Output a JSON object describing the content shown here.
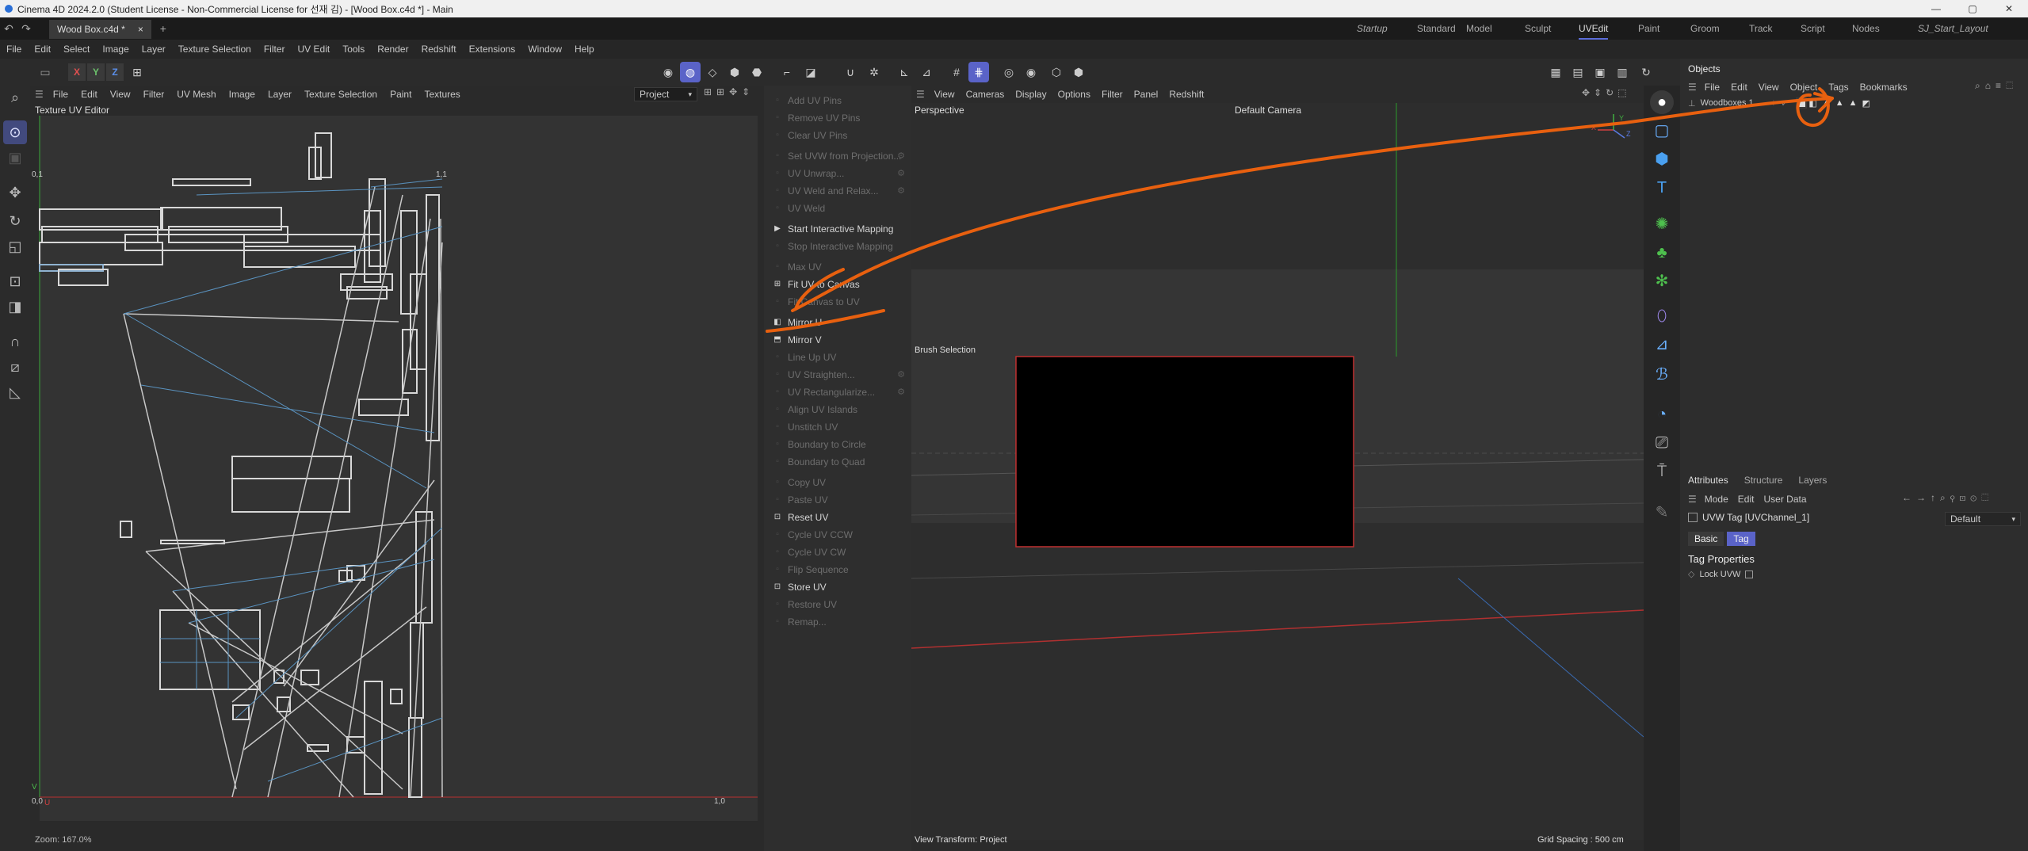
{
  "window": {
    "title": "Cinema 4D 2024.2.0 (Student License - Non-Commercial License for 선재 김) - [Wood Box.c4d *] - Main",
    "minimize": "—",
    "maximize": "▢",
    "close": "✕"
  },
  "tabbar": {
    "doc_tab": "Wood Box.c4d *",
    "doc_close": "×",
    "new_tab": "+",
    "layouts": [
      "Startup",
      "Standard",
      "Model",
      "Sculpt",
      "UVEdit",
      "Paint",
      "Groom",
      "Track",
      "Script",
      "Nodes",
      "SJ_Start_Layout"
    ],
    "active_layout": "UVEdit"
  },
  "menubar": [
    "File",
    "Edit",
    "Select",
    "Image",
    "Layer",
    "Texture Selection",
    "Filter",
    "UV Edit",
    "Tools",
    "Render",
    "Redshift",
    "Extensions",
    "Window",
    "Help"
  ],
  "toolbar": {
    "axes": [
      "X",
      "Y",
      "Z"
    ]
  },
  "uv_editor": {
    "menu": [
      "File",
      "Edit",
      "View",
      "Filter",
      "UV Mesh",
      "Image",
      "Layer",
      "Texture Selection",
      "Paint",
      "Textures"
    ],
    "title": "Texture UV Editor",
    "projection": "Project",
    "corner_tl": "0,1",
    "corner_tr": "1,1",
    "corner_bl": "0,0",
    "corner_br": "1,0",
    "axis_u": "U",
    "axis_v": "V",
    "zoom": "Zoom: 167.0%"
  },
  "uv_commands": [
    {
      "label": "Add UV Pins",
      "enabled": false,
      "gear": false
    },
    {
      "label": "Remove UV Pins",
      "enabled": false,
      "gear": false
    },
    {
      "label": "Clear UV Pins",
      "enabled": false,
      "gear": false
    },
    {
      "sep": true
    },
    {
      "label": "Set UVW from Projection...",
      "enabled": false,
      "gear": true
    },
    {
      "label": "UV Unwrap...",
      "enabled": false,
      "gear": true
    },
    {
      "label": "UV Weld and Relax...",
      "enabled": false,
      "gear": true
    },
    {
      "label": "UV Weld",
      "enabled": false,
      "gear": false
    },
    {
      "sep": true
    },
    {
      "label": "Start Interactive Mapping",
      "enabled": true,
      "gear": false,
      "icon": "▶"
    },
    {
      "label": "Stop Interactive Mapping",
      "enabled": false,
      "gear": false
    },
    {
      "sep": true
    },
    {
      "label": "Max UV",
      "enabled": false,
      "gear": false
    },
    {
      "label": "Fit UV to Canvas",
      "enabled": true,
      "gear": false,
      "icon": "⊞"
    },
    {
      "label": "Fit Canvas to UV",
      "enabled": false,
      "gear": false
    },
    {
      "sep": true
    },
    {
      "label": "Mirror U",
      "enabled": true,
      "gear": false,
      "icon": "◧"
    },
    {
      "label": "Mirror V",
      "enabled": true,
      "gear": false,
      "icon": "⬒"
    },
    {
      "label": "Line Up UV",
      "enabled": false,
      "gear": false
    },
    {
      "label": "UV Straighten...",
      "enabled": false,
      "gear": true
    },
    {
      "label": "UV Rectangularize...",
      "enabled": false,
      "gear": true
    },
    {
      "label": "Align UV Islands",
      "enabled": false,
      "gear": false
    },
    {
      "label": "Unstitch UV",
      "enabled": false,
      "gear": false
    },
    {
      "label": "Boundary to Circle",
      "enabled": false,
      "gear": false
    },
    {
      "label": "Boundary to Quad",
      "enabled": false,
      "gear": false
    },
    {
      "sep": true
    },
    {
      "label": "Copy UV",
      "enabled": false,
      "gear": false
    },
    {
      "label": "Paste UV",
      "enabled": false,
      "gear": false
    },
    {
      "label": "Reset UV",
      "enabled": true,
      "gear": false,
      "icon": "⊡"
    },
    {
      "label": "Cycle UV CCW",
      "enabled": false,
      "gear": false
    },
    {
      "label": "Cycle UV CW",
      "enabled": false,
      "gear": false
    },
    {
      "label": "Flip Sequence",
      "enabled": false,
      "gear": false
    },
    {
      "label": "Store UV",
      "enabled": true,
      "gear": false,
      "icon": "⊡"
    },
    {
      "label": "Restore UV",
      "enabled": false,
      "gear": false
    },
    {
      "label": "Remap...",
      "enabled": false,
      "gear": false
    }
  ],
  "viewport": {
    "menu": [
      "View",
      "Cameras",
      "Display",
      "Options",
      "Filter",
      "Panel",
      "Redshift"
    ],
    "camera_label": "Perspective",
    "default_camera": "Default Camera",
    "brush_selection": "Brush Selection",
    "view_transform": "View Transform: Project",
    "grid_spacing": "Grid Spacing : 500 cm",
    "axis_x": "X",
    "axis_y": "Y",
    "axis_z": "Z"
  },
  "objects": {
    "title": "Objects",
    "menu": [
      "File",
      "Edit",
      "View",
      "Object",
      "Tags",
      "Bookmarks"
    ],
    "item": "Woodboxes.1"
  },
  "attributes": {
    "tabs": [
      "Attributes",
      "Structure",
      "Layers"
    ],
    "active_tab": "Attributes",
    "menu": [
      "Mode",
      "Edit",
      "User Data"
    ],
    "tag_title": "UVW Tag [UVChannel_1]",
    "preset": "Default",
    "subtabs": [
      "Basic",
      "Tag"
    ],
    "active_subtab": "Tag",
    "section": "Tag Properties",
    "lock_label": "Lock UVW"
  },
  "annotation_color": "#e8600f",
  "accent_color": "#5a63c8"
}
